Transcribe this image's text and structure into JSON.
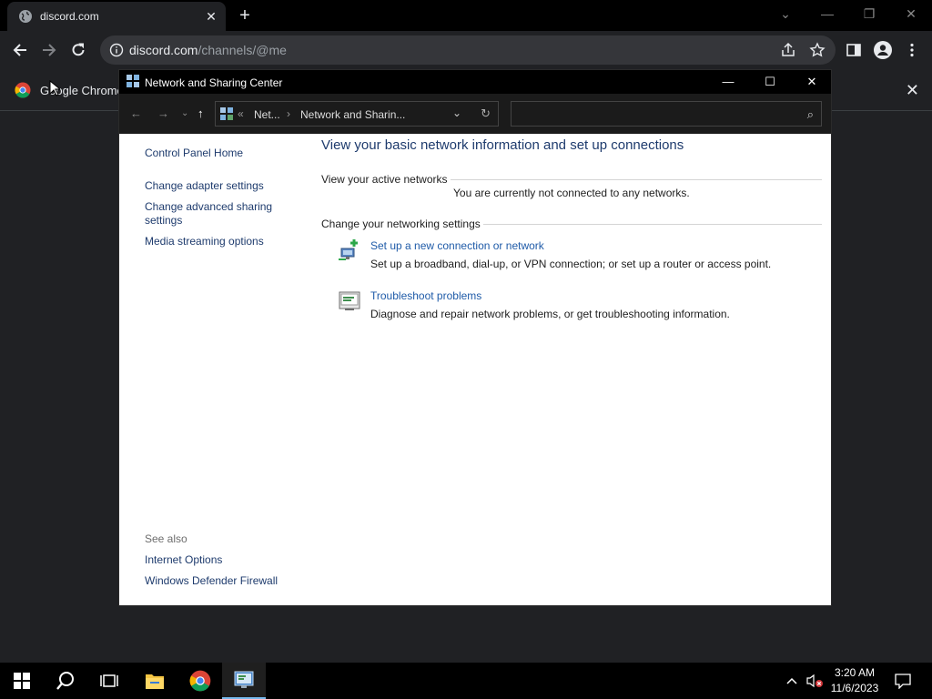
{
  "browser": {
    "tab_title": "discord.com",
    "tab_close": "✕",
    "new_tab": "+",
    "url_host": "discord.com",
    "url_path": "/channels/@me",
    "bookmark_label": "Google Chrome",
    "bookmark_close": "✕"
  },
  "window": {
    "title": "Network and Sharing Center",
    "minimize": "—",
    "maximize": "☐",
    "close": "✕",
    "breadcrumb_overflow": "«",
    "breadcrumbs": [
      "Net...",
      "Network and Sharin..."
    ],
    "breadcrumb_sep": "›",
    "search_placeholder": ""
  },
  "leftnav": {
    "home": "Control Panel Home",
    "items": [
      "Change adapter settings",
      "Change advanced sharing settings",
      "Media streaming options"
    ],
    "see_also_header": "See also",
    "see_also": [
      "Internet Options",
      "Windows Defender Firewall"
    ]
  },
  "main": {
    "heading": "View your basic network information and set up connections",
    "active_networks_label": "View your active networks",
    "not_connected": "You are currently not connected to any networks.",
    "change_settings_label": "Change your networking settings",
    "tasks": [
      {
        "link": "Set up a new connection or network",
        "desc": "Set up a broadband, dial-up, or VPN connection; or set up a router or access point.",
        "icon": "network-setup-icon"
      },
      {
        "link": "Troubleshoot problems",
        "desc": "Diagnose and repair network problems, or get troubleshooting information.",
        "icon": "troubleshoot-icon"
      }
    ]
  },
  "taskbar": {
    "time": "3:20 AM",
    "date": "11/6/2023",
    "accent": "#76b9ed"
  },
  "icons": [
    "chrome-icon",
    "info-icon",
    "share-icon",
    "star-icon",
    "sidepanel-icon",
    "profile-icon",
    "menu-icon",
    "windows-start-icon",
    "search-icon",
    "task-view-icon",
    "file-explorer-icon",
    "control-panel-icon",
    "volume-muted-icon",
    "notification-icon"
  ]
}
